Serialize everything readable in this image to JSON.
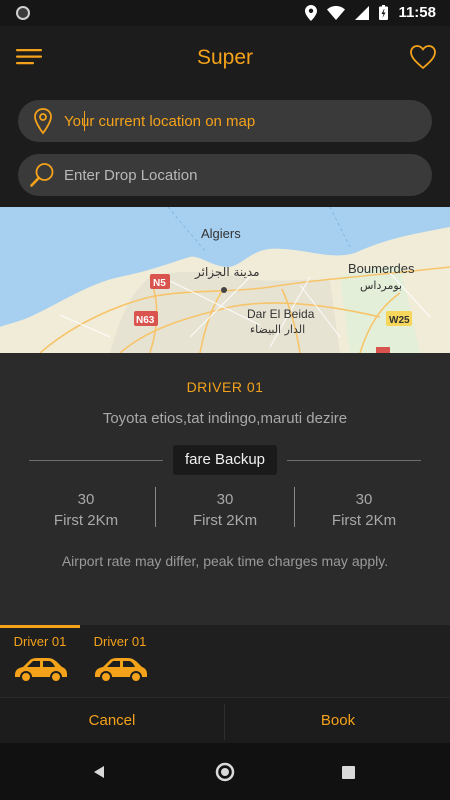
{
  "status_bar": {
    "time": "11:58"
  },
  "header": {
    "title": "Super"
  },
  "search": {
    "pickup_placeholder": "Your current location on map",
    "drop_placeholder": "Enter Drop Location"
  },
  "map": {
    "labels": {
      "algiers": "Algiers",
      "algiers_ar": "مدينة الجزائر",
      "boumerdes": "Boumerdes",
      "boumerdes_ar": "بومرداس",
      "dar_el_beida": "Dar El Beida",
      "dar_el_beida_ar": "الدار البيضاء",
      "n5": "N5",
      "n63": "N63",
      "w25": "W25"
    }
  },
  "driver_panel": {
    "driver_name": "DRIVER 01",
    "vehicles": "Toyota etios,tat indingo,maruti dezire",
    "fare_chip": "fare Backup",
    "fares": [
      {
        "amount": "30",
        "label": "First 2Km"
      },
      {
        "amount": "30",
        "label": "First 2Km"
      },
      {
        "amount": "30",
        "label": "First 2Km"
      }
    ],
    "note": "Airport rate may differ, peak time charges may apply."
  },
  "tabs": [
    {
      "label": "Driver 01",
      "icon": "car-icon",
      "selected": true
    },
    {
      "label": "Driver 01",
      "icon": "car-icon",
      "selected": false
    }
  ],
  "actions": {
    "cancel": "Cancel",
    "book": "Book"
  },
  "colors": {
    "accent": "#f4a21a",
    "background": "#1c1c1c",
    "panel": "#2b2b2b",
    "field": "#3a3a3a"
  }
}
